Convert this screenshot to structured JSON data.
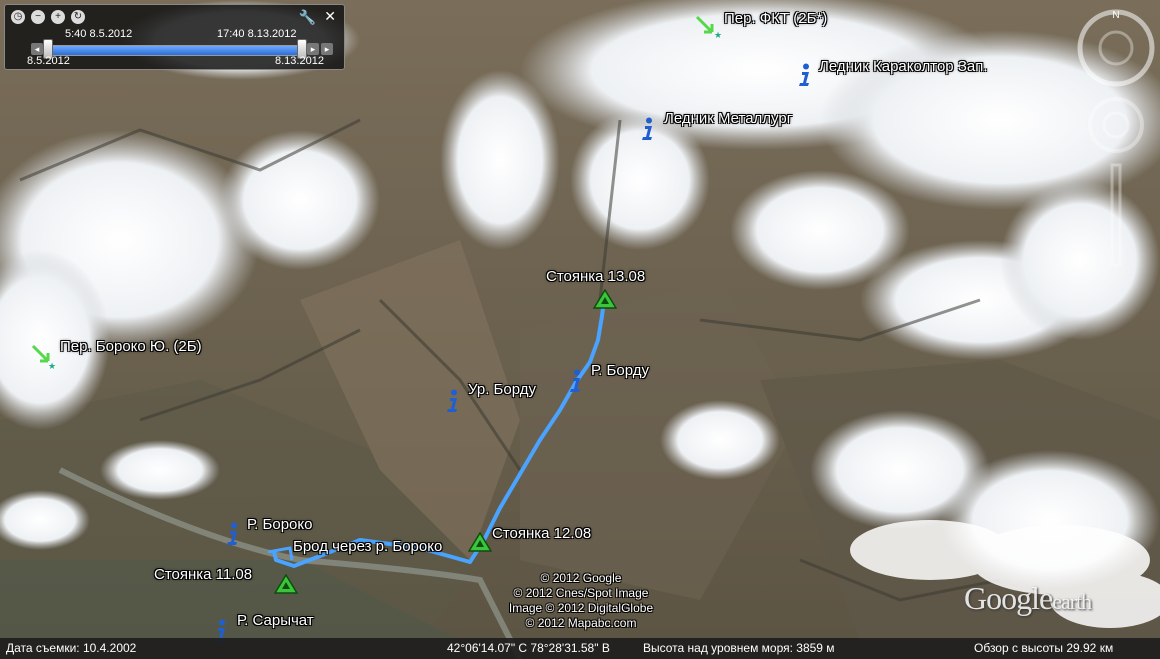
{
  "colors": {
    "track": "#4aa3ff",
    "info_icon": "#1f5fd1",
    "camp_icon": "#3cc43c",
    "pass_arrow": "#55d84a"
  },
  "time_slider": {
    "start_time": "5:40 8.5.2012",
    "end_time": "17:40 8.13.2012",
    "range_start": "8.5.2012",
    "range_end": "8.13.2012",
    "selected_fraction": 1.0
  },
  "placemarks": {
    "pass_fkt": "Пер. ФКТ (2Б*)",
    "glacier_karakoltor": "Ледник Караколтор Зап.",
    "glacier_metallurg": "Ледник Металлург",
    "pass_boroko": "Пер. Бороко Ю. (2Б)",
    "camp_1308": "Стоянка 13.08",
    "river_bordu": "Р. Борду",
    "tract_bordu": "Ур. Борду",
    "river_boroko": "Р. Бороко",
    "ford_boroko": "Брод через р. Бороко",
    "camp_1208": "Стоянка 12.08",
    "camp_1108": "Стоянка 11.08",
    "river_sarychat": "Р. Сарычат"
  },
  "attribution": {
    "line1": "© 2012 Google",
    "line2": "© 2012 Cnes/Spot Image",
    "line3": "Image © 2012 DigitalGlobe",
    "line4": "© 2012 Mapabc.com"
  },
  "logo": {
    "text1": "Google",
    "text2": "earth"
  },
  "status": {
    "imagery_date": "Дата съемки: 10.4.2002",
    "coordinates": "42°06'14.07\" С  78°28'31.58\" В",
    "elevation": "Высота над уровнем моря:  3859 м",
    "eye_alt": "Обзор с высоты    29.92 км"
  },
  "icons": {
    "clock": "clock-icon",
    "zoom_out": "zoom-out-icon",
    "zoom_in": "zoom-in-icon",
    "history": "history-icon",
    "wrench": "wrench-icon",
    "close": "close-icon",
    "north": "N"
  }
}
